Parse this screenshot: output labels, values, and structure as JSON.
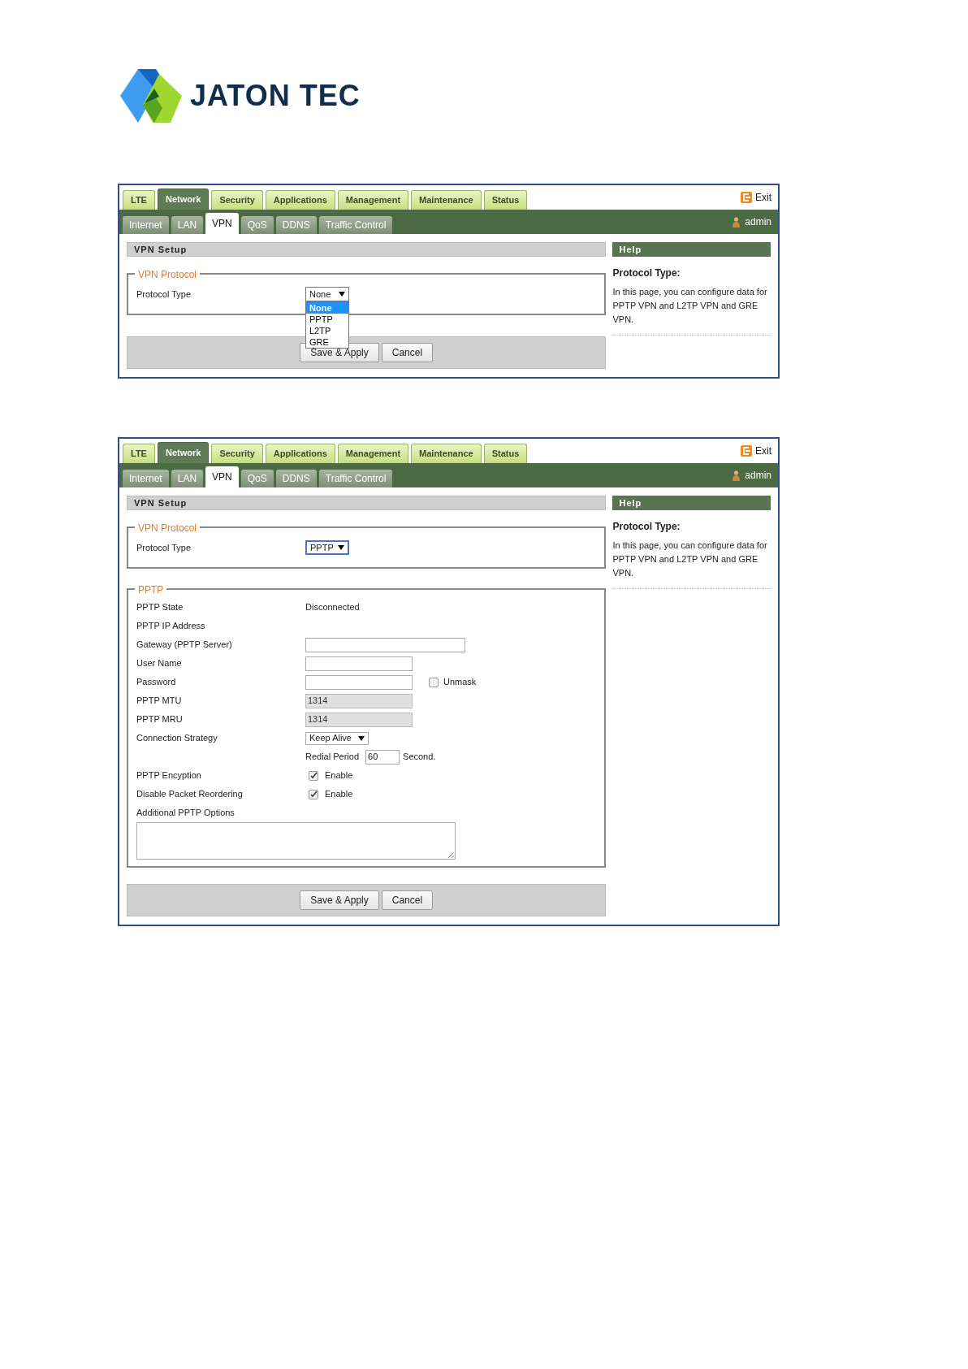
{
  "logo": {
    "text": "JATON TEC"
  },
  "screens": [
    {
      "main_tabs": [
        {
          "label": "LTE",
          "selected": false
        },
        {
          "label": "Network",
          "selected": true
        },
        {
          "label": "Security",
          "selected": false
        },
        {
          "label": "Applications",
          "selected": false
        },
        {
          "label": "Management",
          "selected": false
        },
        {
          "label": "Maintenance",
          "selected": false
        },
        {
          "label": "Status",
          "selected": false
        }
      ],
      "sub_tabs": [
        {
          "label": "Internet",
          "selected": false
        },
        {
          "label": "LAN",
          "selected": false
        },
        {
          "label": "VPN",
          "selected": true
        },
        {
          "label": "QoS",
          "selected": false
        },
        {
          "label": "DDNS",
          "selected": false
        },
        {
          "label": "Traffic Control",
          "selected": false
        }
      ],
      "exit": "Exit",
      "user": "admin",
      "section_title": "VPN Setup",
      "vpn_protocol": {
        "legend": "VPN Protocol",
        "label": "Protocol Type",
        "value": "None",
        "expanded": true,
        "options": [
          {
            "label": "None",
            "selected": true
          },
          {
            "label": "PPTP",
            "selected": false
          },
          {
            "label": "L2TP",
            "selected": false
          },
          {
            "label": "GRE",
            "selected": false
          }
        ]
      },
      "buttons": [
        "Save & Apply",
        "Cancel"
      ],
      "help": {
        "title": "Help",
        "heading": "Protocol Type:",
        "text": "In this page, you can configure data for PPTP VPN and L2TP VPN and GRE VPN."
      }
    },
    {
      "main_tabs": [
        {
          "label": "LTE",
          "selected": false
        },
        {
          "label": "Network",
          "selected": true
        },
        {
          "label": "Security",
          "selected": false
        },
        {
          "label": "Applications",
          "selected": false
        },
        {
          "label": "Management",
          "selected": false
        },
        {
          "label": "Maintenance",
          "selected": false
        },
        {
          "label": "Status",
          "selected": false
        }
      ],
      "sub_tabs": [
        {
          "label": "Internet",
          "selected": false
        },
        {
          "label": "LAN",
          "selected": false
        },
        {
          "label": "VPN",
          "selected": true
        },
        {
          "label": "QoS",
          "selected": false
        },
        {
          "label": "DDNS",
          "selected": false
        },
        {
          "label": "Traffic Control",
          "selected": false
        }
      ],
      "exit": "Exit",
      "user": "admin",
      "section_title": "VPN Setup",
      "vpn_protocol": {
        "legend": "VPN Protocol",
        "label": "Protocol Type",
        "value": "PPTP",
        "expanded": false
      },
      "pptp": {
        "legend": "PPTP",
        "rows": [
          {
            "kind": "text",
            "label": "PPTP State",
            "value": "Disconnected"
          },
          {
            "kind": "text",
            "label": "PPTP IP Address"
          },
          {
            "kind": "wide_input",
            "label": "Gateway (PPTP Server)"
          },
          {
            "kind": "input",
            "label": "User Name"
          },
          {
            "kind": "password",
            "label": "Password",
            "option": "Unmask",
            "checked": false
          },
          {
            "kind": "input",
            "label": "PPTP MTU",
            "value": "1314",
            "disabled": true
          },
          {
            "kind": "input",
            "label": "PPTP MRU",
            "value": "1314",
            "disabled": true
          },
          {
            "kind": "select",
            "label": "Connection Strategy",
            "value": "Keep Alive"
          },
          {
            "kind": "redial",
            "label": "Redial Period",
            "value": "60",
            "unit": "Second."
          },
          {
            "kind": "checkbox",
            "label": "PPTP Encyption",
            "option": "Enable",
            "checked": true
          },
          {
            "kind": "checkbox",
            "label": "Disable Packet Reordering",
            "option": "Enable",
            "checked": true
          },
          {
            "kind": "textarea",
            "label": "Additional PPTP Options"
          }
        ]
      },
      "buttons": [
        "Save & Apply",
        "Cancel"
      ],
      "help": {
        "title": "Help",
        "heading": "Protocol Type:",
        "text": "In this page, you can configure data for PPTP VPN and L2TP VPN and GRE VPN."
      }
    }
  ]
}
